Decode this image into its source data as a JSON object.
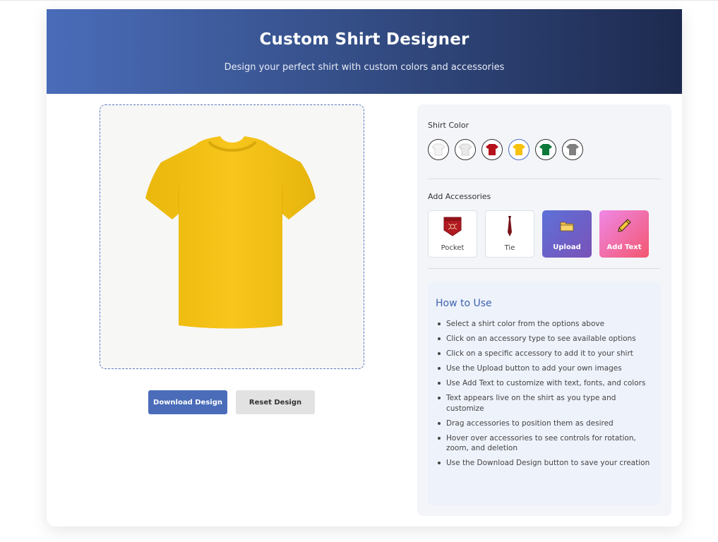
{
  "header": {
    "title": "Custom Shirt Designer",
    "subtitle": "Design your perfect shirt with custom colors and accessories"
  },
  "canvas": {
    "shirt_color": "#f7c20d"
  },
  "actions": {
    "download_label": "Download Design",
    "reset_label": "Reset Design"
  },
  "panel": {
    "shirt_color_label": "Shirt Color",
    "swatches": [
      {
        "name": "white",
        "color": "#f4f4f4",
        "selected": false
      },
      {
        "name": "light-gray",
        "color": "#e9e9e9",
        "selected": false
      },
      {
        "name": "red",
        "color": "#b5121b",
        "selected": false
      },
      {
        "name": "yellow",
        "color": "#f7c20d",
        "selected": true
      },
      {
        "name": "green",
        "color": "#0d7a3a",
        "selected": false
      },
      {
        "name": "gray",
        "color": "#808080",
        "selected": false
      }
    ],
    "accessories_label": "Add Accessories",
    "accessories": [
      {
        "label": "Pocket",
        "icon": "pocket-icon"
      },
      {
        "label": "Tie",
        "icon": "tie-icon"
      },
      {
        "label": "Upload",
        "icon": "folder-icon"
      },
      {
        "label": "Add Text",
        "icon": "pencil-icon"
      }
    ]
  },
  "how_to": {
    "title": "How to Use",
    "steps": [
      "Select a shirt color from the options above",
      "Click on an accessory type to see available options",
      "Click on a specific accessory to add it to your shirt",
      "Use the Upload button to add your own images",
      "Use Add Text to customize with text, fonts, and colors",
      "Text appears live on the shirt as you type and customize",
      "Drag accessories to position them as desired",
      "Hover over accessories to see controls for rotation, zoom, and deletion",
      "Use the Download Design button to save your creation"
    ]
  },
  "colors": {
    "accent": "#4a6cb9",
    "header_dark": "#1d2a4f"
  }
}
